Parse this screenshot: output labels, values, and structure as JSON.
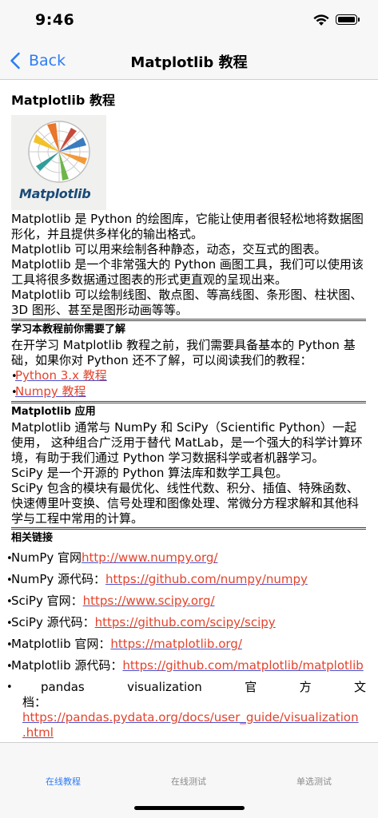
{
  "status": {
    "time": "9:46"
  },
  "nav": {
    "back_label": "Back",
    "title": "Matplotlib 教程"
  },
  "article": {
    "title": "Matplotlib 教程",
    "logo_text": "Matplotlib",
    "intro": [
      "Matplotlib 是 Python 的绘图库，它能让使用者很轻松地将数据图形化，并且提供多样化的输出格式。",
      "Matplotlib 可以用来绘制各种静态，动态，交互式的图表。",
      "Matplotlib 是一个非常强大的 Python 画图工具，我们可以使用该工具将很多数据通过图表的形式更直观的呈现出来。",
      "Matplotlib 可以绘制线图、散点图、等高线图、条形图、柱状图、3D 图形、甚至是图形动画等等。"
    ],
    "prereq": {
      "heading": "学习本教程前你需要了解",
      "text": "在开学习 Matplotlib 教程之前，我们需要具备基本的 Python 基础，如果你对 Python 还不了解，可以阅读我们的教程：",
      "links": [
        "Python 3.x 教程",
        "Numpy 教程"
      ]
    },
    "usage": {
      "heading": "Matplotlib 应用",
      "paragraphs": [
        "Matplotlib 通常与 NumPy 和 SciPy（Scientific Python）一起使用， 这种组合广泛用于替代 MatLab，是一个强大的科学计算环境，有助于我们通过 Python 学习数据科学或者机器学习。",
        "SciPy 是一个开源的 Python 算法库和数学工具包。",
        "SciPy 包含的模块有最优化、线性代数、积分、插值、特殊函数、快速傅里叶变换、信号处理和图像处理、常微分方程求解和其他科学与工程中常用的计算。"
      ]
    },
    "related": {
      "heading": "相关链接",
      "items": [
        {
          "label": "NumPy 官网 ",
          "url": "http://www.numpy.org/"
        },
        {
          "label": "NumPy 源代码：",
          "url": "https://github.com/numpy/numpy"
        },
        {
          "label": "SciPy 官网：",
          "url": "https://www.scipy.org/"
        },
        {
          "label": "SciPy 源代码：",
          "url": "https://github.com/scipy/scipy"
        },
        {
          "label": "Matplotlib 官网：",
          "url": "https://matplotlib.org/"
        },
        {
          "label": "Matplotlib 源代码：",
          "url": "https://github.com/matplotlib/matplotlib"
        }
      ],
      "last": {
        "words": [
          "pandas",
          "visualization",
          "官",
          "方",
          "文"
        ],
        "label_tail": "档：",
        "url_part1": "https://pandas.pydata.org/docs/user_guide/visualization",
        "url_part2": ".html"
      }
    }
  },
  "tabs": [
    {
      "label": "在线教程",
      "active": true
    },
    {
      "label": "在线测试",
      "active": false
    },
    {
      "label": "单选测试",
      "active": false
    }
  ]
}
